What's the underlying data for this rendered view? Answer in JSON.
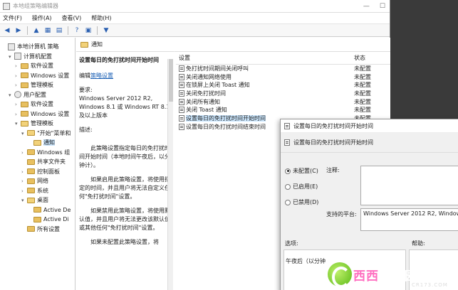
{
  "window": {
    "title": "本地组策略编辑器"
  },
  "menu": [
    "文件(F)",
    "操作(A)",
    "查看(V)",
    "帮助(H)"
  ],
  "tree": [
    {
      "label": "本地计算机 策略",
      "indent": 0,
      "arrow": "",
      "icon": "computer"
    },
    {
      "label": "计算机配置",
      "indent": 1,
      "arrow": "▾",
      "icon": "computer"
    },
    {
      "label": "软件设置",
      "indent": 2,
      "arrow": "›",
      "icon": "folder"
    },
    {
      "label": "Windows 设置",
      "indent": 2,
      "arrow": "›",
      "icon": "folder"
    },
    {
      "label": "管理模板",
      "indent": 2,
      "arrow": "›",
      "icon": "folder"
    },
    {
      "label": "用户配置",
      "indent": 1,
      "arrow": "▾",
      "icon": "user"
    },
    {
      "label": "软件设置",
      "indent": 2,
      "arrow": "›",
      "icon": "folder"
    },
    {
      "label": "Windows 设置",
      "indent": 2,
      "arrow": "›",
      "icon": "folder"
    },
    {
      "label": "管理模板",
      "indent": 2,
      "arrow": "▾",
      "icon": "folder"
    },
    {
      "label": "\"开始\"菜单和",
      "indent": 3,
      "arrow": "▾",
      "icon": "folder"
    },
    {
      "label": "通知",
      "indent": 4,
      "arrow": "",
      "icon": "folder",
      "selected": true
    },
    {
      "label": "Windows 组",
      "indent": 3,
      "arrow": "›",
      "icon": "folder"
    },
    {
      "label": "共享文件夹",
      "indent": 3,
      "arrow": "",
      "icon": "folder"
    },
    {
      "label": "控制面板",
      "indent": 3,
      "arrow": "›",
      "icon": "folder"
    },
    {
      "label": "网络",
      "indent": 3,
      "arrow": "›",
      "icon": "folder"
    },
    {
      "label": "系统",
      "indent": 3,
      "arrow": "›",
      "icon": "folder"
    },
    {
      "label": "桌面",
      "indent": 3,
      "arrow": "▾",
      "icon": "folder"
    },
    {
      "label": "Active De",
      "indent": 4,
      "arrow": "",
      "icon": "folder"
    },
    {
      "label": "Active Di",
      "indent": 4,
      "arrow": "",
      "icon": "folder"
    },
    {
      "label": "所有设置",
      "indent": 3,
      "arrow": "",
      "icon": "folder"
    }
  ],
  "content": {
    "path_label": "通知",
    "desc": {
      "title": "设置每日的免打扰时间开始时间",
      "edit_prefix": "编辑",
      "edit_link": "策略设置",
      "req_label": "要求:",
      "req_text": "Windows Server 2012 R2, Windows 8.1 或 Windows RT 8.1 及以上版本",
      "desc_label": "描述:",
      "p1": "此策略设置指定每日的免打扰时间开始时间（本地时间午夜后，以分钟计）。",
      "p2": "如果启用此策略设置，将使用指定的时间，并且用户将无法自定义任何\"免打扰时间\"设置。",
      "p3": "如果禁用此策略设置，将使用默认值，并且用户将无法更改该默认值或其他任何\"免打扰时间\"设置。",
      "p4": "如果未配置此策略设置，将"
    },
    "list_header": {
      "setting": "设置",
      "status": "状态"
    },
    "rows": [
      {
        "name": "免打扰时间期间关闭呼叫",
        "status": "未配置"
      },
      {
        "name": "关闭通知网络使用",
        "status": "未配置"
      },
      {
        "name": "在锁屏上关闭 Toast 通知",
        "status": "未配置"
      },
      {
        "name": "关闭免打扰时间",
        "status": "未配置"
      },
      {
        "name": "关闭所有通知",
        "status": "未配置"
      },
      {
        "name": "关闭 Toast 通知",
        "status": "未配置"
      },
      {
        "name": "设置每日的免打扰时间开始时间",
        "status": "未配置",
        "highlight": true
      },
      {
        "name": "设置每日的免打扰时间结束时间",
        "status": "未配置"
      }
    ]
  },
  "dialog": {
    "title": "设置每日的免打扰时间开始时间",
    "header": "设置每日的免打扰时间开始时间",
    "radio_not_configured": "未配置(C)",
    "radio_enabled": "已启用(E)",
    "radio_disabled": "已禁用(D)",
    "comment_label": "注释:",
    "platform_label": "支持的平台:",
    "platform_value": "Windows Server 2012 R2, Window",
    "options_label": "选项:",
    "help_label": "帮助:",
    "option_field": "午夜后（以分钟"
  },
  "watermark": {
    "text_a": "西西",
    "text_b": "软件园",
    "sub": "CR173.COM"
  }
}
